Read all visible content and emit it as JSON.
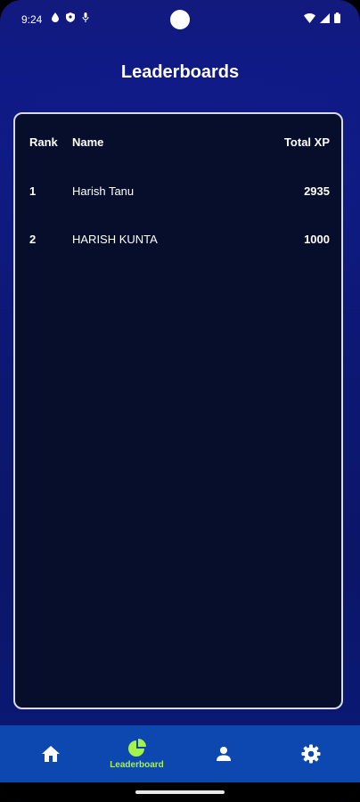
{
  "status_bar": {
    "time": "9:24",
    "left_icons": [
      "water-drop-icon",
      "shield-icon",
      "microphone-icon"
    ],
    "right_icons": [
      "wifi-icon",
      "signal-icon",
      "battery-icon"
    ]
  },
  "header": {
    "title": "Leaderboards"
  },
  "leaderboard": {
    "columns": {
      "rank": "Rank",
      "name": "Name",
      "xp": "Total XP"
    },
    "rows": [
      {
        "rank": "1",
        "name": "Harish Tanu",
        "xp": "2935"
      },
      {
        "rank": "2",
        "name": "HARISH KUNTA",
        "xp": "1000"
      }
    ]
  },
  "bottom_nav": {
    "items": [
      {
        "icon": "home-icon",
        "label": "",
        "active": false
      },
      {
        "icon": "pie-chart-icon",
        "label": "Leaderboard",
        "active": true
      },
      {
        "icon": "person-icon",
        "label": "",
        "active": false
      },
      {
        "icon": "gear-icon",
        "label": "",
        "active": false
      }
    ]
  },
  "colors": {
    "background": "#0d1878",
    "card": "#060e2b",
    "nav": "#0d47b0",
    "accent": "#a5f24a",
    "text": "#ffffff"
  }
}
